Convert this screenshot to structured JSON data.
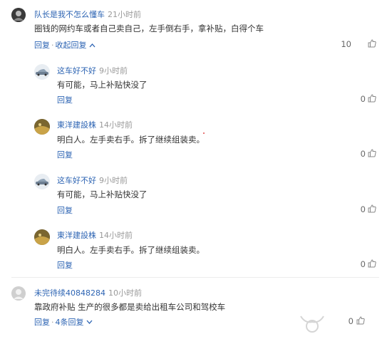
{
  "comments": {
    "c1": {
      "user": "队长是我不怎么懂车",
      "time": "21小时前",
      "text": "圈钱的网约车或者自己卖自己，左手倒右手，拿补贴，白得个车",
      "reply_label": "回复",
      "collapse_label": "收起回复",
      "likes": "10"
    },
    "r1": {
      "user": "这车好不好",
      "time": "9小时前",
      "text": "有可能，马上补贴快没了",
      "reply_label": "回复",
      "likes": "0"
    },
    "r2": {
      "user": "東洋建設株",
      "time": "14小时前",
      "text": "明白人。左手卖右手。拆了继续组装卖。",
      "reply_label": "回复",
      "likes": "0"
    },
    "r3": {
      "user": "这车好不好",
      "time": "9小时前",
      "text": "有可能，马上补贴快没了",
      "reply_label": "回复",
      "likes": "0"
    },
    "r4": {
      "user": "東洋建設株",
      "time": "14小时前",
      "text": "明白人。左手卖右手。拆了继续组装卖。",
      "reply_label": "回复",
      "likes": "0"
    },
    "c2": {
      "user": "未完待续40848284",
      "time": "10小时前",
      "text": "靠政府补贴 生产的很多都是卖给出租车公司和驾校车",
      "reply_label": "回复",
      "expand_label": "4条回复",
      "likes": "0"
    }
  },
  "colors": {
    "link": "#2d64b3",
    "muted": "#999999"
  }
}
